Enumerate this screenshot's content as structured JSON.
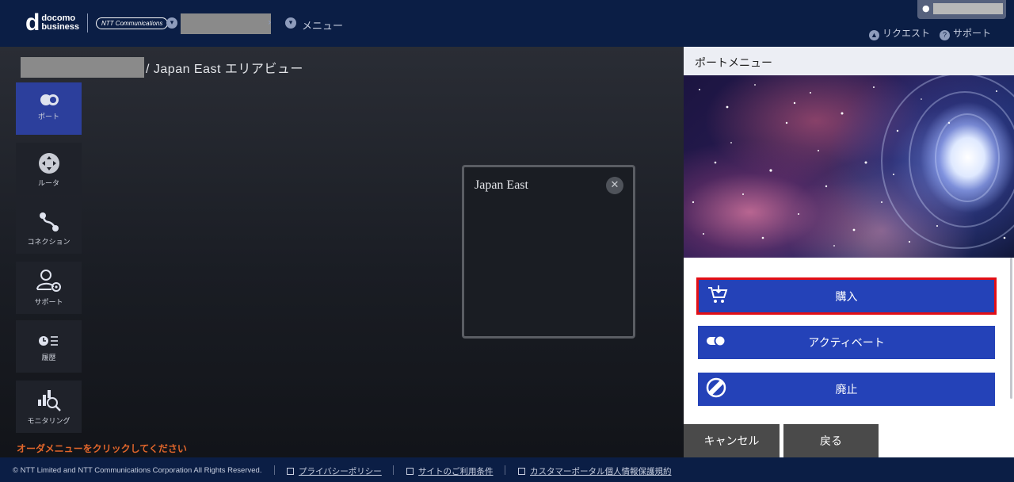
{
  "header": {
    "logo_d": "d",
    "logo_line1": "docomo",
    "logo_line2": "business",
    "logo_ntt": "NTT Communications",
    "breadcrumb_chevron": "chevron-down-icon",
    "breadcrumb_menu": "メニュー",
    "links": [
      {
        "label": "リクエスト",
        "icon": "bell-icon"
      },
      {
        "label": "サポート",
        "icon": "question-icon"
      }
    ]
  },
  "main": {
    "title": "/ Japan East エリアビュー",
    "sidebar": [
      {
        "label": "ポート",
        "icon": "port-icon",
        "active": true
      },
      {
        "label": "ルータ",
        "icon": "router-icon",
        "active": false
      },
      {
        "label": "コネクション",
        "icon": "connection-icon",
        "active": false
      },
      {
        "label": "サポート",
        "icon": "support-user-gear-icon",
        "active": false
      },
      {
        "label": "履歴",
        "icon": "history-icon",
        "active": false
      },
      {
        "label": "モニタリング",
        "icon": "monitoring-icon",
        "active": false
      }
    ],
    "order_hint": "オーダメニューをクリックしてください",
    "region_card": {
      "name": "Japan East",
      "close_glyph": "✕"
    }
  },
  "panel": {
    "title": "ポートメニュー",
    "actions": [
      {
        "label": "購入",
        "icon": "cart-icon",
        "selected": true
      },
      {
        "label": "アクティベート",
        "icon": "toggle-icon",
        "selected": false
      },
      {
        "label": "廃止",
        "icon": "ban-icon",
        "selected": false
      }
    ],
    "cancel_label": "キャンセル",
    "back_label": "戻る"
  },
  "footer": {
    "copyright": "© NTT Limited and NTT Communications Corporation All Rights Reserved.",
    "links": [
      "プライバシーポリシー",
      "サイトのご利用条件",
      "カスタマーポータル個人情報保護規約"
    ]
  },
  "colors": {
    "header_bg": "#0b1e45",
    "accent_blue": "#2442b8",
    "selected_border": "#e20e15",
    "hint_orange": "#e2662b"
  }
}
